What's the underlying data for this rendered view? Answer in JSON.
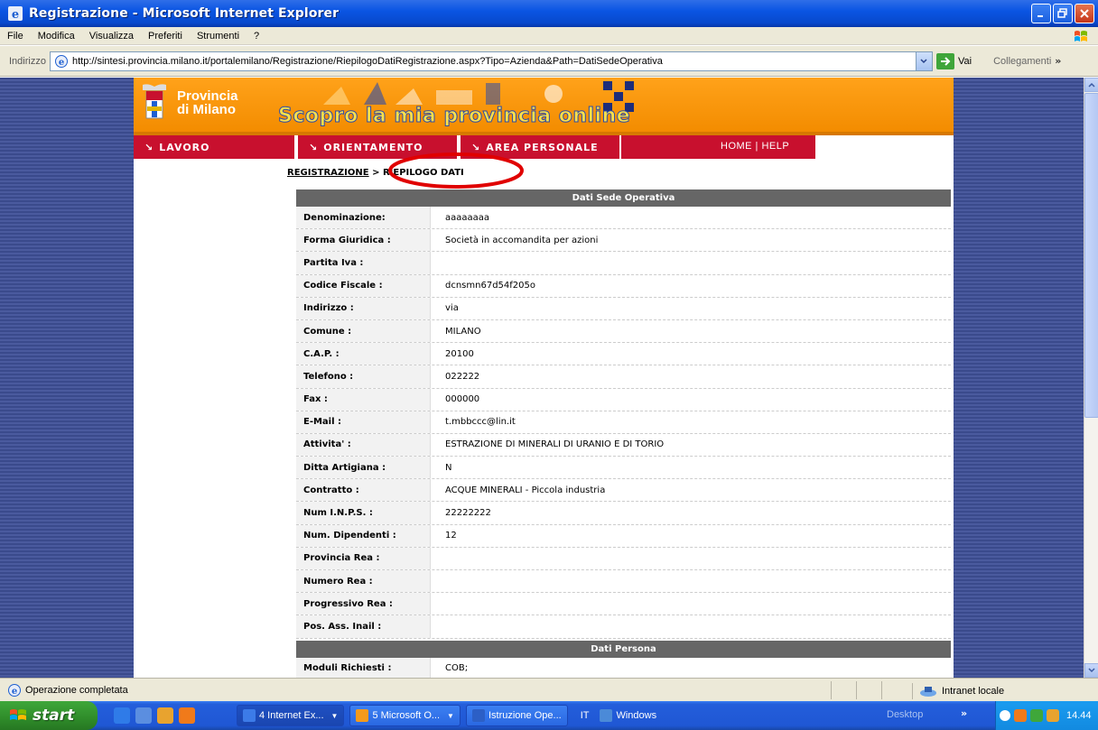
{
  "window": {
    "title": "Registrazione - Microsoft Internet Explorer"
  },
  "menu": [
    "File",
    "Modifica",
    "Visualizza",
    "Preferiti",
    "Strumenti",
    "?"
  ],
  "address": {
    "label": "Indirizzo",
    "url": "http://sintesi.provincia.milano.it/portalemilano/Registrazione/RiepilogoDatiRegistrazione.aspx?Tipo=Azienda&Path=DatiSedeOperativa",
    "go_label": "Vai",
    "links_label": "Collegamenti"
  },
  "site": {
    "logo_line1": "Provincia",
    "logo_line2": "di Milano",
    "slogan": "Scopro la mia provincia online",
    "nav": {
      "lavoro": "LAVORO",
      "orientamento": "ORIENTAMENTO",
      "area_personale": "AREA PERSONALE",
      "home_help": "HOME | HELP"
    },
    "breadcrumb": {
      "link": "REGISTRAZIONE",
      "current": "> RIEPILOGO DATI"
    },
    "section1_title": "Dati Sede Operativa",
    "rows": [
      {
        "label": "Denominazione:",
        "value": "aaaaaaaa"
      },
      {
        "label": "Forma Giuridica :",
        "value": "Società in accomandita per azioni"
      },
      {
        "label": "Partita Iva :",
        "value": ""
      },
      {
        "label": "Codice Fiscale :",
        "value": "dcnsmn67d54f205o"
      },
      {
        "label": "Indirizzo :",
        "value": "via"
      },
      {
        "label": "Comune :",
        "value": "MILANO"
      },
      {
        "label": "C.A.P. :",
        "value": "20100"
      },
      {
        "label": "Telefono :",
        "value": "022222"
      },
      {
        "label": "Fax :",
        "value": "000000"
      },
      {
        "label": "E-Mail :",
        "value": "t.mbbccc@lin.it"
      },
      {
        "label": "Attivita' :",
        "value": "ESTRAZIONE DI MINERALI DI URANIO E DI TORIO"
      },
      {
        "label": "Ditta Artigiana :",
        "value": "N"
      },
      {
        "label": "Contratto :",
        "value": "ACQUE MINERALI - Piccola industria"
      },
      {
        "label": "Num I.N.P.S. :",
        "value": "22222222"
      },
      {
        "label": "Num. Dipendenti :",
        "value": "12"
      },
      {
        "label": "Provincia Rea :",
        "value": ""
      },
      {
        "label": "Numero Rea :",
        "value": ""
      },
      {
        "label": "Progressivo Rea :",
        "value": ""
      },
      {
        "label": "Pos. Ass. Inail :",
        "value": ""
      }
    ],
    "section2_title": "Dati Persona",
    "rows2": [
      {
        "label": "Moduli Richiesti :",
        "value": "COB;"
      }
    ]
  },
  "status": {
    "text": "Operazione completata",
    "zone": "Intranet locale"
  },
  "taskbar": {
    "start": "start",
    "buttons": [
      {
        "label": "4 Internet Ex...",
        "icon_color": "#3c7be8"
      },
      {
        "label": "5 Microsoft O...",
        "icon_color": "#f39a1c"
      },
      {
        "label": "Istruzione Ope...",
        "icon_color": "#2c5fc6"
      },
      {
        "label": "Windows",
        "icon_color": "#4b8ad8"
      }
    ],
    "lang": "IT",
    "desktop": "Desktop",
    "clock": "14.44"
  },
  "colors": {
    "banner_orange": "#f59100",
    "nav_red": "#c8102e",
    "header_gray": "#666666"
  }
}
